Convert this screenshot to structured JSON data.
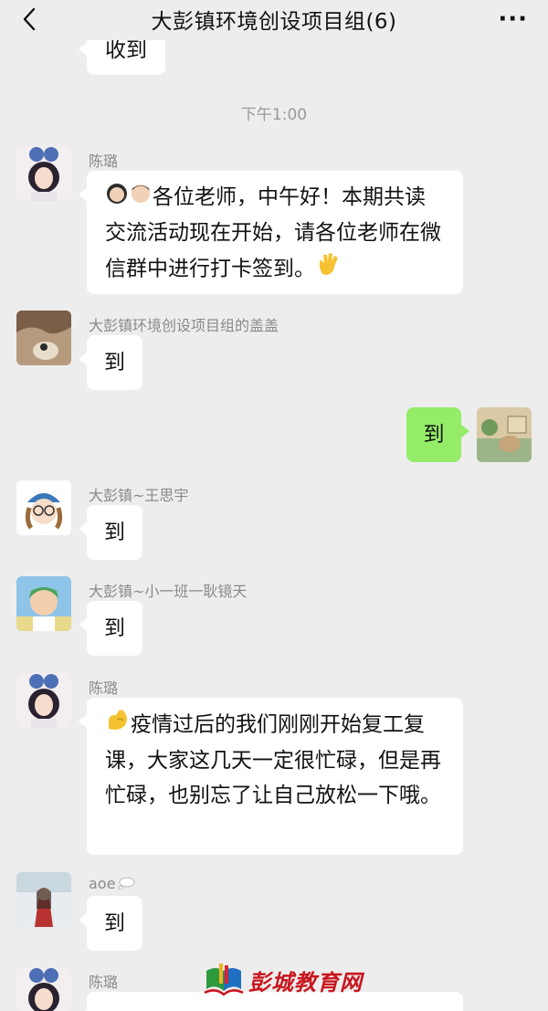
{
  "header": {
    "title": "大彭镇环境创设项目组(6)",
    "more_label": "···"
  },
  "messages": {
    "top_partial": "收到",
    "time": "下午1:00",
    "m1": {
      "sender": "陈璐",
      "text": "各位老师，中午好！本期共读交流活动现在开始，请各位老师在微信群中进行打卡签到。"
    },
    "m2": {
      "sender": "大彭镇环境创设项目组的盖盖",
      "text": "到"
    },
    "m3": {
      "text": "到"
    },
    "m4": {
      "sender": "大彭镇~王思宇",
      "text": "到"
    },
    "m5": {
      "sender": "大彭镇~小一班一耿镜天",
      "text": "到"
    },
    "m6": {
      "sender": "陈璐",
      "text": "疫情过后的我们刚刚开始复工复课，大家这几天一定很忙碌，但是再忙碌，也别忘了让自己放松一下哦。"
    },
    "m7": {
      "sender": "aoe",
      "text": "到"
    },
    "m8": {
      "sender": "陈璐"
    }
  },
  "watermark": {
    "text": "彭城教育网"
  },
  "colors": {
    "background": "#ededed",
    "self_bubble": "#95ec69",
    "other_bubble": "#ffffff"
  }
}
